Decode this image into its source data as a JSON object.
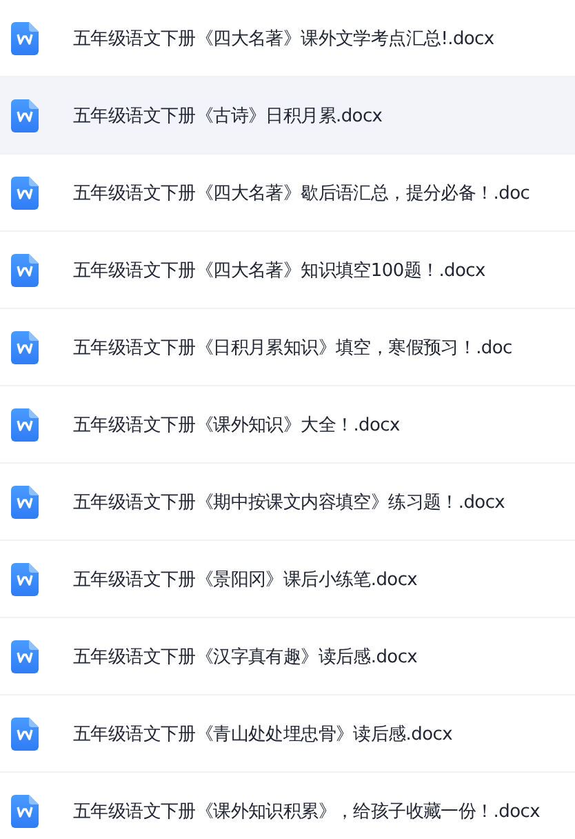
{
  "files": [
    {
      "name": "五年级语文下册《四大名著》课外文学考点汇总!.docx",
      "selected": false
    },
    {
      "name": "五年级语文下册《古诗》日积月累.docx",
      "selected": true
    },
    {
      "name": "五年级语文下册《四大名著》歇后语汇总，提分必备！.doc",
      "selected": false
    },
    {
      "name": "五年级语文下册《四大名著》知识填空100题！.docx",
      "selected": false
    },
    {
      "name": "五年级语文下册《日积月累知识》填空，寒假预习！.doc",
      "selected": false
    },
    {
      "name": "五年级语文下册《课外知识》大全！.docx",
      "selected": false
    },
    {
      "name": "五年级语文下册《期中按课文内容填空》练习题！.docx",
      "selected": false
    },
    {
      "name": "五年级语文下册《景阳冈》课后小练笔.docx",
      "selected": false
    },
    {
      "name": "五年级语文下册《汉字真有趣》读后感.docx",
      "selected": false
    },
    {
      "name": "五年级语文下册《青山处处埋忠骨》读后感.docx",
      "selected": false
    },
    {
      "name": "五年级语文下册《课外知识积累》，给孩子收藏一份！.docx",
      "selected": false
    }
  ]
}
